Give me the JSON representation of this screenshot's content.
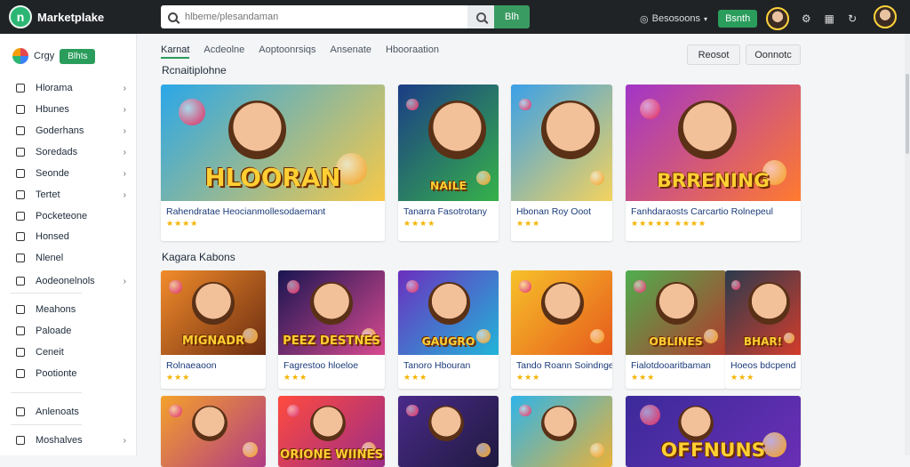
{
  "app": {
    "name": "Marketplake",
    "logo_letter": "n"
  },
  "search": {
    "placeholder": "hlbeme/plesandaman",
    "go_label": "Blh"
  },
  "topbar": {
    "sessions_label": "Besosoons",
    "green_button": "Bsnth"
  },
  "sidebar": {
    "head_label": "Crgy",
    "head_button": "Blhts",
    "items": [
      {
        "label": "Hlorama",
        "icon": "home-icon",
        "chevron": true
      },
      {
        "label": "Hbunes",
        "icon": "box-icon",
        "chevron": true
      },
      {
        "label": "Goderhans",
        "icon": "mail-icon",
        "chevron": true
      },
      {
        "label": "Soredads",
        "icon": "doc-icon",
        "chevron": true
      },
      {
        "label": "Seonde",
        "icon": "gear-icon",
        "chevron": true
      },
      {
        "label": "Tertet",
        "icon": "grid-icon",
        "chevron": true
      },
      {
        "label": "Pocketeone",
        "icon": "pocket-icon",
        "chevron": false
      },
      {
        "label": "Honsed",
        "icon": "link-icon",
        "chevron": false
      },
      {
        "label": "Nlenel",
        "icon": "bell-icon",
        "chevron": false
      },
      {
        "label": "Aodeonelnols",
        "icon": "shield-icon",
        "chevron": true
      },
      {
        "label": "Meahons",
        "icon": "chat-icon",
        "chevron": false
      },
      {
        "label": "Paloade",
        "icon": "file-icon",
        "chevron": false
      },
      {
        "label": "Ceneit",
        "icon": "clock-icon",
        "chevron": false
      },
      {
        "label": "Pootionte",
        "icon": "star-icon",
        "chevron": false
      },
      {
        "label": "Anlenoats",
        "icon": "pencil-icon",
        "chevron": false
      },
      {
        "label": "Moshalves",
        "icon": "list-icon",
        "chevron": true
      }
    ]
  },
  "tabs": [
    "Karnat",
    "Acdeolne",
    "Aoptoonrsiqs",
    "Ansenate",
    "Hbooraation"
  ],
  "actions": {
    "primary": "Reosot",
    "secondary": "Oonnotc"
  },
  "sections": {
    "featured_title": "Rcnaitiplohne",
    "recent_title": "Kagara Kabons"
  },
  "featured": [
    {
      "title": "Rahendratae Heocianmollesodaemant",
      "stars": "★★★★",
      "art_text": "HLOORAN",
      "bg": [
        "#2aa7e8",
        "#f7c948"
      ]
    },
    {
      "title": "Tanarra Fasotrotany",
      "stars": "★★★★",
      "art_text": "NAILE",
      "bg": [
        "#1b3c86",
        "#36b24a"
      ]
    },
    {
      "title": "Hbonan Roy Ooot",
      "stars": "★★★",
      "art_text": "",
      "bg": [
        "#3aa0e8",
        "#f4d35e"
      ]
    },
    {
      "title": "Fanhdaraosts Carcartio Rolnepeul",
      "stars": "★★★★★ ★★★★",
      "art_text": "BRRENING",
      "bg": [
        "#a235c8",
        "#ff7a2f"
      ]
    }
  ],
  "recent": [
    {
      "title": "Rolnaeaoon",
      "stars": "★★★",
      "art_text": "MIGNADR",
      "bg": [
        "#f28c2b",
        "#6b2c10"
      ]
    },
    {
      "title": "Fagrestoo hloeloe",
      "stars": "★★★",
      "art_text": "PEEZ DESTNES",
      "bg": [
        "#1a1552",
        "#d84a8f"
      ]
    },
    {
      "title": "Tanoro Hbouran",
      "stars": "★★★",
      "art_text": "GAUGRO",
      "bg": [
        "#6b2fbf",
        "#22b5d8"
      ]
    },
    {
      "title": "Tando Roann Soindnge",
      "stars": "★★★",
      "art_text": "",
      "bg": [
        "#f7c12a",
        "#e65a1c"
      ]
    },
    {
      "title": "Fialotdooaritbaman",
      "stars": "★★★",
      "art_text": "OBLINES",
      "bg": [
        "#4fae4f",
        "#b33a2d"
      ]
    },
    {
      "title": "Hoeos bdcpend",
      "stars": "★★★",
      "art_text": "BHAR!",
      "bg": [
        "#2b3b4d",
        "#d23c2c"
      ]
    }
  ],
  "third_row": [
    {
      "art_text": "",
      "bg": [
        "#f4a12b",
        "#b13a85"
      ]
    },
    {
      "art_text": "ORIONE WIINES",
      "bg": [
        "#ff4b3e",
        "#9b2c88"
      ]
    },
    {
      "art_text": "",
      "bg": [
        "#4a2a8a",
        "#1f1a3f"
      ]
    },
    {
      "art_text": "",
      "bg": [
        "#2fb4e8",
        "#e8b23a"
      ]
    },
    {
      "art_text": "OFFNUNS",
      "bg": [
        "#3b2a9a",
        "#6a2fb5"
      ]
    }
  ]
}
